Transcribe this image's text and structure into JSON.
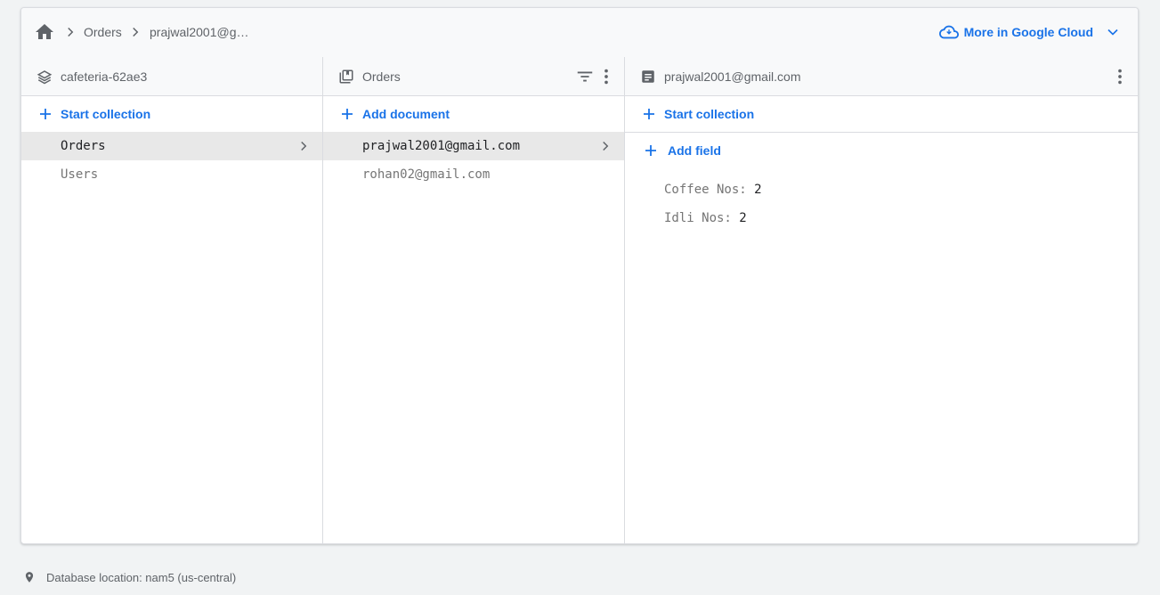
{
  "breadcrumb": {
    "items": [
      "Orders",
      "prajwal2001@g…"
    ]
  },
  "header": {
    "more_cloud_label": "More in Google Cloud"
  },
  "columns": {
    "project": {
      "title": "cafeteria-62ae3",
      "action_label": "Start collection",
      "items": [
        {
          "label": "Orders",
          "selected": true
        },
        {
          "label": "Users",
          "selected": false
        }
      ]
    },
    "collection": {
      "title": "Orders",
      "action_label": "Add document",
      "items": [
        {
          "label": "prajwal2001@gmail.com",
          "selected": true
        },
        {
          "label": "rohan02@gmail.com",
          "selected": false
        }
      ]
    },
    "document": {
      "title": "prajwal2001@gmail.com",
      "start_collection_label": "Start collection",
      "add_field_label": "Add field",
      "fields": [
        {
          "key": "Coffee Nos:",
          "value": "2"
        },
        {
          "key": "Idli Nos:",
          "value": "2"
        }
      ]
    }
  },
  "footer": {
    "location": "Database location: nam5 (us-central)"
  },
  "colors": {
    "accent": "#1a73e8",
    "muted": "#5f6368",
    "background": "#f1f3f4",
    "selected_row": "#e8e8e8"
  },
  "icons": [
    "home-icon",
    "chevron-right-icon",
    "cloud-icon",
    "chevron-down-icon",
    "stack-icon",
    "collection-icon",
    "filter-icon",
    "more-vert-icon",
    "document-icon",
    "plus-icon",
    "location-pin-icon"
  ]
}
